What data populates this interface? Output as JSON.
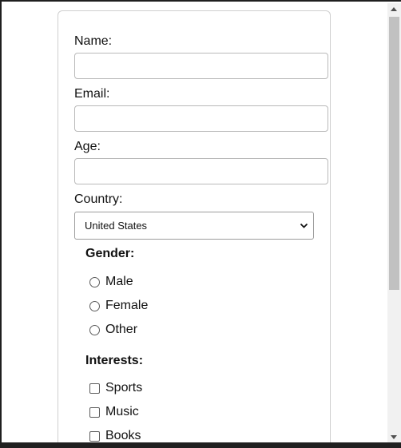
{
  "form": {
    "name_label": "Name:",
    "name_value": "",
    "email_label": "Email:",
    "email_value": "",
    "age_label": "Age:",
    "age_value": "",
    "country_label": "Country:",
    "country_selected": "United States",
    "gender": {
      "title": "Gender:",
      "options": [
        "Male",
        "Female",
        "Other"
      ]
    },
    "interests": {
      "title": "Interests:",
      "options": [
        "Sports",
        "Music",
        "Books"
      ]
    }
  },
  "icons": {
    "select_arrow": "chevron-down-icon",
    "scroll_up": "arrow-up-icon",
    "scroll_down": "arrow-down-icon"
  }
}
